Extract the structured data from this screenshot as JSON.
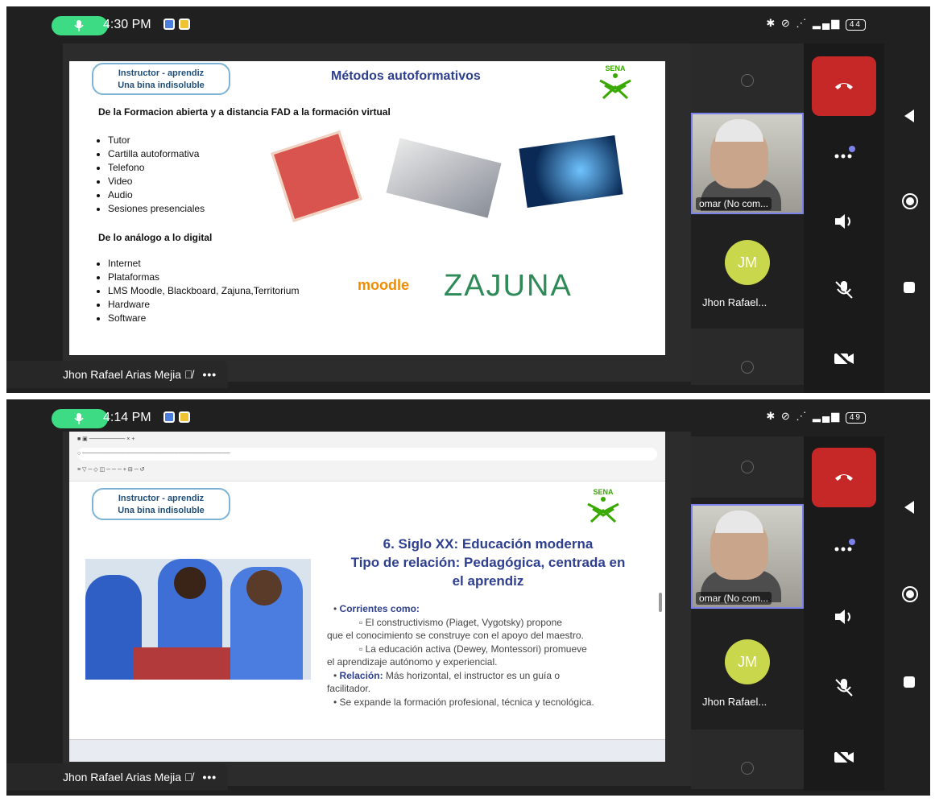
{
  "top": {
    "time": "4:30 PM",
    "battery": "44",
    "slide": {
      "badge_line1": "Instructor - aprendiz",
      "badge_line2": "Una bina indisoluble",
      "title": "Métodos autoformativos",
      "sena": "SENA",
      "heading1": "De la Formacion abierta y a distancia FAD  a la formación virtual",
      "list1": [
        "Tutor",
        "Cartilla autoformativa",
        "Telefono",
        "Video",
        "Audio",
        "Sesiones presenciales"
      ],
      "heading2": "De lo análogo a lo digital",
      "list2": [
        "Internet",
        "Plataformas",
        "LMS Moodle, Blackboard, Zajuna,Territorium",
        "Hardware",
        "Software"
      ],
      "moodle": "moodle",
      "zajuna": "ZAJUNA"
    },
    "presenter": "Jhon Rafael Arias Mejia",
    "cam_label": "omar (No com...",
    "jm_initials": "JM",
    "jm_name": "Jhon Rafael..."
  },
  "bottom": {
    "time": "4:14 PM",
    "battery": "49",
    "slide": {
      "badge_line1": "Instructor - aprendiz",
      "badge_line2": "Una bina indisoluble",
      "sena": "SENA",
      "title_line1": "6. Siglo XX: Educación moderna",
      "title_line2": "Tipo de relación: Pedagógica, centrada en",
      "title_line3": "el aprendiz",
      "bullet1_label": "Corrientes como:",
      "sub1a": "El constructivismo (Piaget, Vygotsky) propone",
      "sub1b": "que el conocimiento se construye con el apoyo del maestro.",
      "sub2a": "La educación activa (Dewey, Montessori) promueve",
      "sub2b": "el aprendizaje autónomo y experiencial.",
      "bullet2_label": "Relación:",
      "bullet2_text": "Más horizontal, el instructor es un guía o",
      "bullet2_cont": "facilitador.",
      "bullet3": "Se expande la formación profesional, técnica y tecnológica."
    },
    "presenter": "Jhon Rafael Arias Mejia",
    "cam_label": "omar (No com...",
    "jm_initials": "JM",
    "jm_name": "Jhon Rafael..."
  }
}
